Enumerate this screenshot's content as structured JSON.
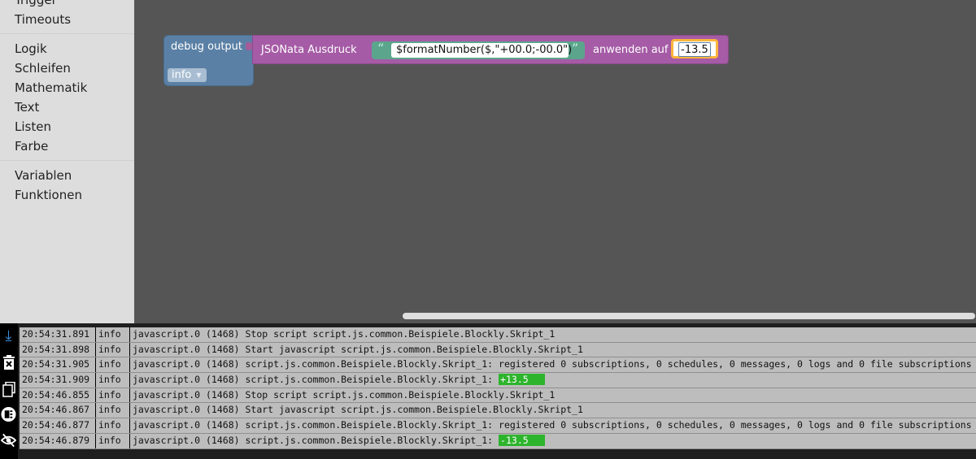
{
  "toolbox": {
    "categories_top": [
      "Trigger",
      "Timeouts"
    ],
    "categories_mid": [
      "Logik",
      "Schleifen",
      "Mathematik",
      "Text",
      "Listen",
      "Farbe"
    ],
    "categories_bottom": [
      "Variablen",
      "Funktionen"
    ]
  },
  "blocks": {
    "debug": {
      "label": "debug output",
      "level": "info"
    },
    "jsonata": {
      "label": "JSONata Ausdruck",
      "expression": "$formatNumber($,\"+00.0;-00.0\")",
      "apply_label": "anwenden auf",
      "value": "-13.5"
    }
  },
  "log": {
    "rows": [
      {
        "time": "20:54:31.891",
        "level": "info",
        "message": "javascript.0 (1468) Stop script script.js.common.Beispiele.Blockly.Skript_1",
        "highlight": ""
      },
      {
        "time": "20:54:31.898",
        "level": "info",
        "message": "javascript.0 (1468) Start javascript script.js.common.Beispiele.Blockly.Skript_1",
        "highlight": ""
      },
      {
        "time": "20:54:31.905",
        "level": "info",
        "message": "javascript.0 (1468) script.js.common.Beispiele.Blockly.Skript_1: registered 0 subscriptions, 0 schedules, 0 messages, 0 logs and 0 file subscriptions",
        "highlight": ""
      },
      {
        "time": "20:54:31.909",
        "level": "info",
        "message": "javascript.0 (1468) script.js.common.Beispiele.Blockly.Skript_1: ",
        "highlight": "+13.5"
      },
      {
        "time": "20:54:46.855",
        "level": "info",
        "message": "javascript.0 (1468) Stop script script.js.common.Beispiele.Blockly.Skript_1",
        "highlight": ""
      },
      {
        "time": "20:54:46.867",
        "level": "info",
        "message": "javascript.0 (1468) Start javascript script.js.common.Beispiele.Blockly.Skript_1",
        "highlight": ""
      },
      {
        "time": "20:54:46.877",
        "level": "info",
        "message": "javascript.0 (1468) script.js.common.Beispiele.Blockly.Skript_1: registered 0 subscriptions, 0 schedules, 0 messages, 0 logs and 0 file subscriptions",
        "highlight": ""
      },
      {
        "time": "20:54:46.879",
        "level": "info",
        "message": "javascript.0 (1468) script.js.common.Beispiele.Blockly.Skript_1: ",
        "highlight": "-13.5"
      }
    ]
  },
  "icons": {
    "scroll_down": "scroll-down-icon",
    "clear": "clear-log-icon",
    "copy": "copy-log-icon",
    "filter": "show-filter-icon",
    "hide": "hide-icon"
  },
  "colors": {
    "debug_block": "#5b80a5",
    "jsonata_block": "#a55ba5",
    "text_block": "#5ba58c",
    "number_outline": "#fbb53c",
    "log_highlight": "#2db42d"
  }
}
